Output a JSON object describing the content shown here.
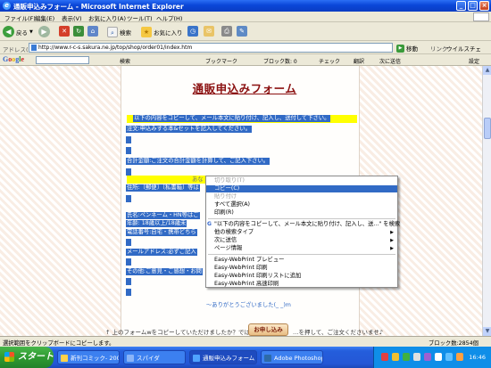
{
  "window": {
    "title": "通販申込みフォーム - Microsoft Internet Explorer"
  },
  "menu": [
    "ファイル(F)",
    "編集(E)",
    "表示(V)",
    "お気に入り(A)",
    "ツール(T)",
    "ヘルプ(H)"
  ],
  "toolbar": {
    "back": "戻る",
    "search": "検索",
    "favorites": "お気に入り"
  },
  "address": {
    "label": "アドレス(D)",
    "url": "http://www.r-c-s.sakura.ne.jp/top/shop/order01/index.htm",
    "go": "移動",
    "links": "リンク",
    "virus": "ウイルスチェ"
  },
  "google": {
    "logo": "Google",
    "items": [
      "検索",
      "ブックマーク",
      "ブロック数: 0",
      "チェック",
      "翻訳",
      "次に送信",
      "設定"
    ]
  },
  "page": {
    "title": "通販申込みフォーム",
    "lines": [
      "以下の内容をコピーして、メール本文に貼り付け、記入し、送付して下さい。",
      "注文:申込みする本&セットを記入してください。",
      "合計金額:ご注文の合計金額を計算して、ご記入下さい。",
      "住所:〔郵便〕〔私書箱〕等は",
      "氏名:ペンネーム・HN等はご",
      "年齢: 18歳以上/18歳未",
      "電話番号:自宅・携帯どちら",
      "メールアドレス:必ずご記入",
      "その他:ご意見・ご感想・お問",
      "～ありがとうございました(_ _)m",
      "あな"
    ],
    "footer_before": "↑ 上のフォームwをコピーしていただけましたか？では…",
    "apply_button": "お申し込み",
    "footer_after": "…を押して、ご注文くださいませ♪"
  },
  "context_menu": {
    "items": [
      {
        "label": "切り取り(T)",
        "state": "disabled"
      },
      {
        "label": "コピー(C)",
        "state": "highlighted"
      },
      {
        "label": "貼り付け",
        "state": "disabled"
      },
      {
        "label": "すべて選択(A)",
        "state": "normal"
      },
      {
        "label": "印刷(R)",
        "state": "normal"
      },
      {
        "label": "\"以下の内容をコピーして、メール本文に貼り付け、記入し、送...\" を検索",
        "state": "normal"
      },
      {
        "label": "他の検索タイプ",
        "state": "normal"
      },
      {
        "label": "次に送信",
        "state": "normal"
      },
      {
        "label": "ページ情報",
        "state": "normal"
      },
      {
        "label": "Easy-WebPrint プレビュー",
        "state": "normal"
      },
      {
        "label": "Easy-WebPrint 印刷",
        "state": "normal"
      },
      {
        "label": "Easy-WebPrint 印刷リストに追加",
        "state": "normal"
      },
      {
        "label": "Easy-WebPrint 高速印刷",
        "state": "normal"
      }
    ]
  },
  "status": {
    "text": "選択範囲をクリップボードにコピーします。",
    "blocked": "ブロック数:2854個"
  },
  "taskbar": {
    "start": "スタート",
    "tasks": [
      "新刊コミック- 2007.10...",
      "スパイダ",
      "通販申込みフォーム - ...",
      "Adobe Photoshop"
    ],
    "clock": "16:46"
  },
  "colors": {
    "selection": "#316ac5",
    "title_red": "#8b1010",
    "highlight_yellow": "#ffff00"
  }
}
